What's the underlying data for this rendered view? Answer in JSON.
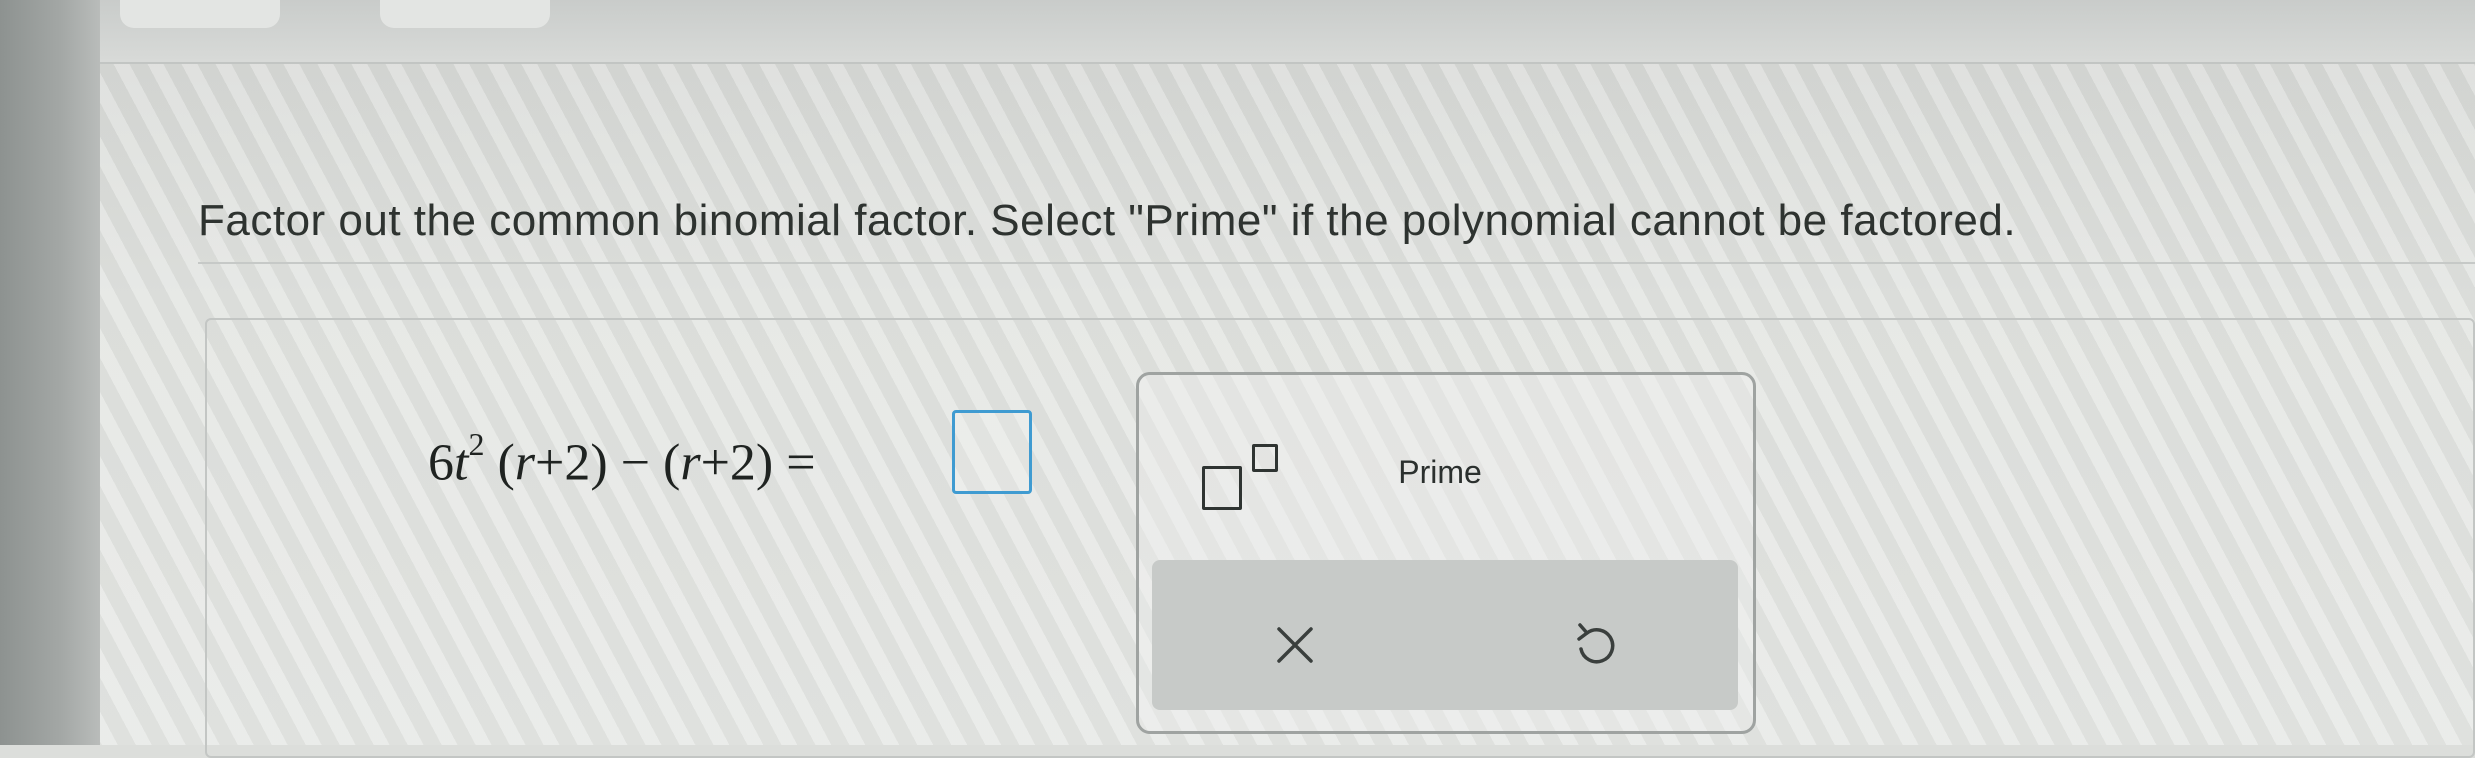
{
  "question": {
    "text": "Factor out the common binomial factor. Select \"Prime\" if the polynomial cannot be factored."
  },
  "equation": {
    "coef": "6",
    "var": "t",
    "exp": "2",
    "part1": "(",
    "r1": "r",
    "plus1": "+2)",
    "minus": " − (",
    "r2": "r",
    "plus2": "+2)",
    "equals": " ="
  },
  "keypad": {
    "prime_label": "Prime"
  },
  "icons": {
    "exponent": "exponent-template-icon",
    "clear": "close-icon",
    "undo": "undo-icon"
  },
  "colors": {
    "answer_box_border": "#3f9bd1"
  }
}
